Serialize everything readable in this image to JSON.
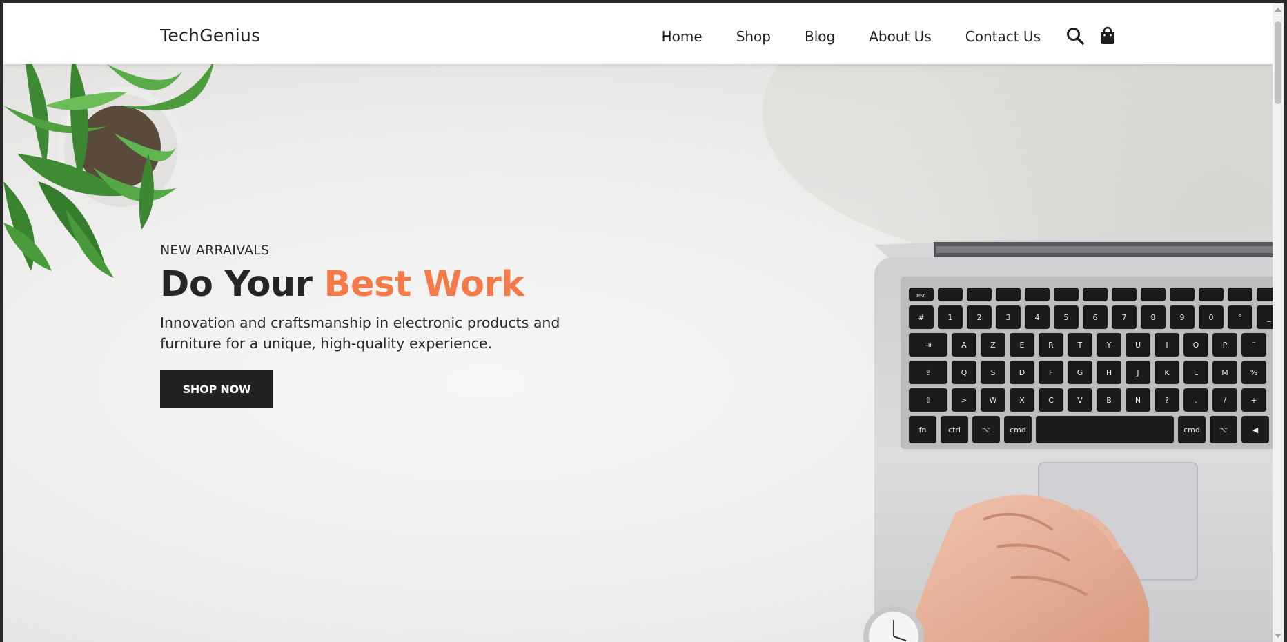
{
  "header": {
    "logo": "TechGenius",
    "nav": [
      "Home",
      "Shop",
      "Blog",
      "About Us",
      "Contact Us"
    ],
    "icons": [
      "search-icon",
      "shopping-bag-icon"
    ]
  },
  "hero": {
    "eyebrow": "NEW ARRAIVALS",
    "headline_part1": "Do Your ",
    "headline_accent": "Best Work",
    "subtext": "Innovation and craftsmanship in electronic products and furniture for a unique, high-quality experience.",
    "cta_label": "SHOP NOW"
  },
  "keyboard": {
    "row1": [
      "esc",
      "",
      "",
      "",
      "",
      "",
      "",
      "",
      "",
      "",
      "",
      "",
      ""
    ],
    "row2": [
      "#",
      "1",
      "2",
      "3",
      "4",
      "5",
      "6",
      "7",
      "8",
      "9",
      "0",
      "°",
      "_"
    ],
    "row3": [
      "⇥",
      "A",
      "Z",
      "E",
      "R",
      "T",
      "Y",
      "U",
      "I",
      "O",
      "P",
      "¨"
    ],
    "row4": [
      "⇪",
      "Q",
      "S",
      "D",
      "F",
      "G",
      "H",
      "J",
      "K",
      "L",
      "M",
      "%"
    ],
    "row5": [
      "⇧",
      ">",
      "W",
      "X",
      "C",
      "V",
      "B",
      "N",
      "?",
      ".",
      "/",
      "+"
    ],
    "row6": [
      "fn",
      "ctrl",
      "⌥",
      "cmd",
      "",
      "cmd",
      "⌥",
      "◀"
    ]
  },
  "colors": {
    "accent": "#f47a4a",
    "text_dark": "#252525",
    "button_bg": "#222222"
  }
}
